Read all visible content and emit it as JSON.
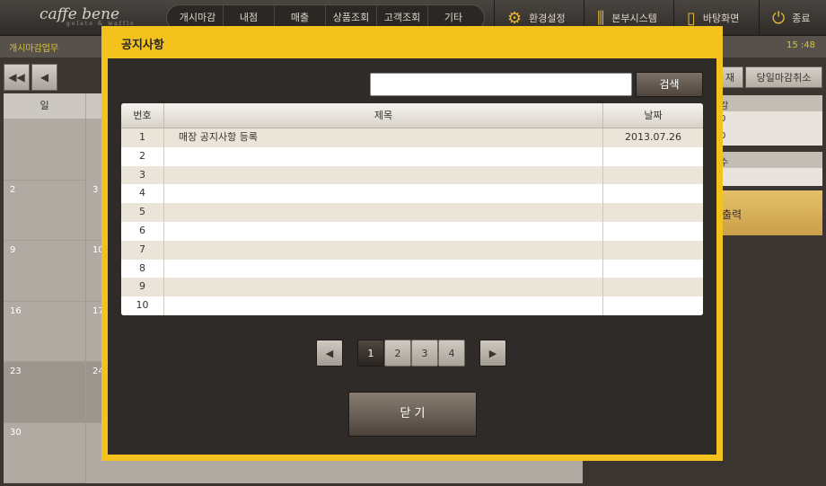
{
  "topbar": {
    "logo_text": "caffe bene",
    "logo_sub": "gelato & waffle",
    "menu": [
      "개시마감",
      "내점",
      "매출",
      "상품조회",
      "고객조회",
      "기타"
    ],
    "settings_label": "환경설정",
    "hq_label": "본부시스템",
    "desktop_label": "바탕화면",
    "exit_label": "종료"
  },
  "subbar": {
    "title": "개시마감업무",
    "time": "15 :48"
  },
  "calendar": {
    "header_first": "일",
    "days": [
      "2",
      "3",
      "9",
      "10",
      "16",
      "17",
      "23",
      "24",
      "30"
    ]
  },
  "right_panel": {
    "btn_partial": "재",
    "cancel_close_label": "당일마감취소",
    "label_1": "감",
    "val_1": "0",
    "val_2": "0",
    "label_2": "수",
    "print_label": "출력"
  },
  "modal": {
    "title": "공지사항",
    "search": {
      "value": "",
      "button_label": "검색"
    },
    "table": {
      "headers": [
        "번호",
        "제목",
        "날짜"
      ],
      "rows": [
        {
          "no": "1",
          "title": "매장 공지사항 등록",
          "date": "2013.07.26"
        },
        {
          "no": "2",
          "title": "",
          "date": ""
        },
        {
          "no": "3",
          "title": "",
          "date": ""
        },
        {
          "no": "4",
          "title": "",
          "date": ""
        },
        {
          "no": "5",
          "title": "",
          "date": ""
        },
        {
          "no": "6",
          "title": "",
          "date": ""
        },
        {
          "no": "7",
          "title": "",
          "date": ""
        },
        {
          "no": "8",
          "title": "",
          "date": ""
        },
        {
          "no": "9",
          "title": "",
          "date": ""
        },
        {
          "no": "10",
          "title": "",
          "date": ""
        }
      ]
    },
    "pagination": {
      "pages": [
        "1",
        "2",
        "3",
        "4"
      ],
      "active": "1"
    },
    "close_label": "닫 기"
  }
}
